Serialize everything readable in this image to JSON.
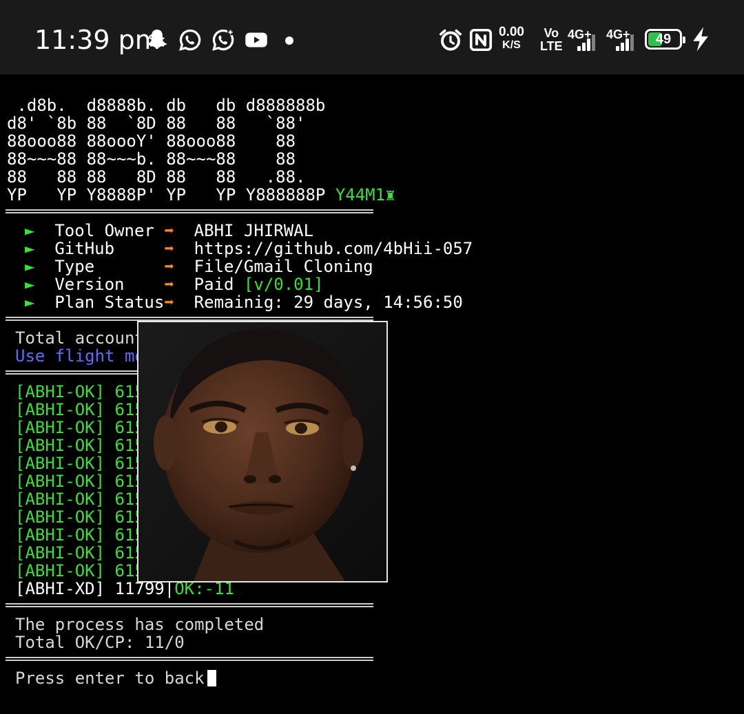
{
  "status_bar": {
    "time": "11:39 pm",
    "net_speed_value": "0.00",
    "net_speed_unit": "K/S",
    "volte_top": "Vo",
    "volte_bottom": "LTE",
    "sim1_label": "4G+",
    "sim2_label": "4G+",
    "battery_level": "49",
    "notification_icons": [
      "snapchat-icon",
      "whatsapp-icon",
      "whatsapp-business-icon",
      "youtube-icon"
    ],
    "system_icons": [
      "alarm-icon",
      "nfc-icon",
      "charging-bolt-icon"
    ]
  },
  "banner": {
    "lines": [
      " .d8b.  d8888b. db   db d888888b",
      "d8' `8b 88  `8D 88   88   `88'",
      "88ooo88 88oooY' 88ooo88    88",
      "88~~~88 88~~~b. 88~~~88    88",
      "88   88 88   8D 88   88   .88.",
      "YP   YP Y8888P' YP   YP Y888888P"
    ],
    "tag": "Y44M1"
  },
  "info": {
    "bullet": "►",
    "arrow": "➡",
    "rows": [
      {
        "label": "Tool Owner ",
        "value": "ABHI JHIRWAL",
        "value_suffix": ""
      },
      {
        "label": "GitHub     ",
        "value": "https://github.com/4bHii-057",
        "value_suffix": ""
      },
      {
        "label": "Type       ",
        "value": "File/Gmail Cloning",
        "value_suffix": ""
      },
      {
        "label": "Version    ",
        "value": "Paid ",
        "value_suffix": "[v/0.01]"
      },
      {
        "label": "Plan Status",
        "value": "Remainig: 29 days, 14:56:50",
        "value_suffix": ""
      }
    ]
  },
  "notice": {
    "total_accounts": "Total account",
    "flight_mode": "Use flight mod"
  },
  "results": {
    "ok_rows": [
      "[ABHI-OK] 6157",
      "[ABHI-OK] 6157",
      "[ABHI-OK] 6157",
      "[ABHI-OK] 6157",
      "[ABHI-OK] 6157",
      "[ABHI-OK] 6157",
      "[ABHI-OK] 6157",
      "[ABHI-OK] 6157",
      "[ABHI-OK] 6157",
      "[ABHI-OK] 6157",
      "[ABHI-OK] 6157"
    ],
    "progress_prefix": "[ABHI-XD] 11799",
    "progress_sep": "|",
    "progress_ok": "OK:-11"
  },
  "summary": {
    "completed": "The process has completed",
    "totals": "Total OK/CP: 11/0"
  },
  "prompt": {
    "text": "Press enter to back"
  },
  "overlay": {
    "kind": "photo"
  },
  "colors": {
    "ok_green": "#38e038",
    "arrow_orange": "#ff8a1a",
    "notice_blue": "#5f6bff",
    "battery_green": "#2ec24a",
    "statusbar_bg": "#1a1a1a"
  }
}
